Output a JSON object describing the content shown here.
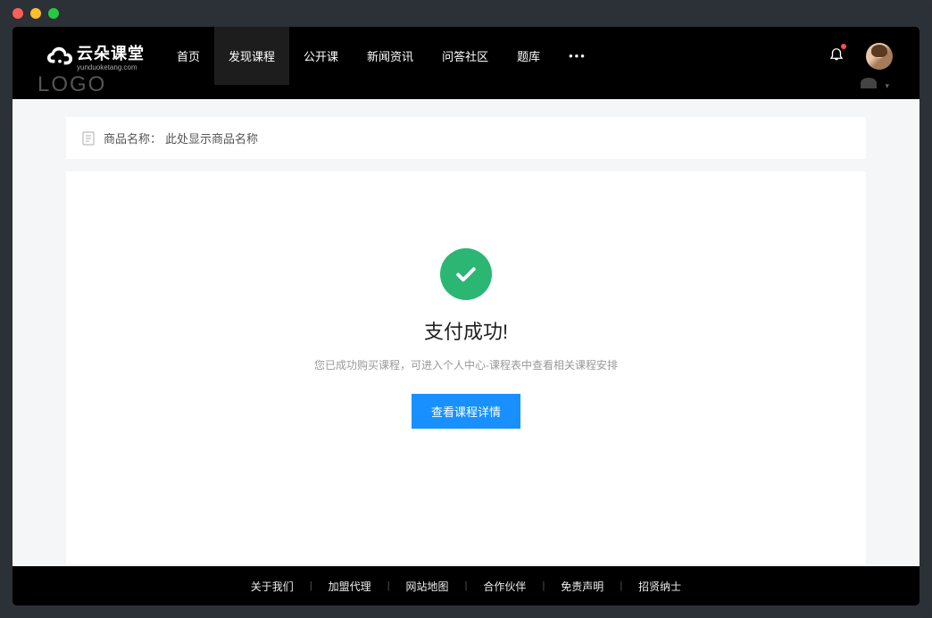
{
  "logo": {
    "main": "云朵课堂",
    "sub": "yunduoketang.com"
  },
  "nav": {
    "items": [
      {
        "label": "首页",
        "active": false
      },
      {
        "label": "发现课程",
        "active": true
      },
      {
        "label": "公开课",
        "active": false
      },
      {
        "label": "新闻资讯",
        "active": false
      },
      {
        "label": "问答社区",
        "active": false
      },
      {
        "label": "题库",
        "active": false
      }
    ]
  },
  "productBar": {
    "label": "商品名称：",
    "value": "此处显示商品名称"
  },
  "success": {
    "title": "支付成功!",
    "subtitle": "您已成功购买课程，可进入个人中心-课程表中查看相关课程安排",
    "button": "查看课程详情"
  },
  "footer": {
    "links": [
      "关于我们",
      "加盟代理",
      "网站地图",
      "合作伙伴",
      "免责声明",
      "招贤纳士"
    ]
  },
  "ghost": {
    "logo": "LOGO"
  }
}
